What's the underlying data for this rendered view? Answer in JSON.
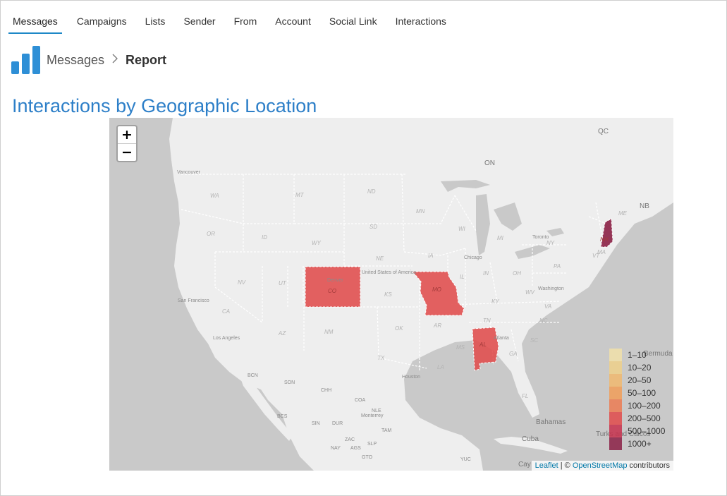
{
  "tabs": [
    {
      "label": "Messages",
      "active": true
    },
    {
      "label": "Campaigns"
    },
    {
      "label": "Lists"
    },
    {
      "label": "Sender"
    },
    {
      "label": "From"
    },
    {
      "label": "Account"
    },
    {
      "label": "Social Link"
    },
    {
      "label": "Interactions"
    }
  ],
  "breadcrumb": {
    "parent": "Messages",
    "separator": ">",
    "current": "Report"
  },
  "page_title": "Interactions by Geographic Location",
  "map": {
    "zoom_in": "+",
    "zoom_out": "−",
    "state_labels": [
      "WA",
      "MT",
      "ND",
      "MN",
      "OR",
      "ID",
      "WY",
      "SD",
      "WI",
      "MI",
      "NY",
      "NE",
      "IA",
      "NV",
      "UT",
      "CO",
      "KS",
      "MO",
      "IL",
      "IN",
      "OH",
      "PA",
      "CA",
      "KY",
      "WV",
      "VA",
      "AZ",
      "NM",
      "OK",
      "AR",
      "TN",
      "NC",
      "TX",
      "MS",
      "AL",
      "GA",
      "SC",
      "LA",
      "FL",
      "NH",
      "MA",
      "ME",
      "VT",
      "NB",
      "QC",
      "ON",
      "BCN",
      "SON",
      "CHH",
      "COA",
      "NLE",
      "TAM",
      "SIN",
      "DUR",
      "BCS",
      "ZAC",
      "SLP",
      "NAY",
      "AGS",
      "GTO",
      "YUC"
    ],
    "city_labels": [
      "Vancouver",
      "San Francisco",
      "Los Angeles",
      "Denver",
      "Chicago",
      "Toronto",
      "Washington",
      "Atlanta",
      "Houston",
      "Monterrey",
      "Bahamas",
      "Cuba",
      "Turks and Caicos",
      "Bermuda",
      "United States of America",
      "Cay"
    ],
    "highlighted": [
      {
        "state": "CO",
        "range": "100–200",
        "color": "#e05050"
      },
      {
        "state": "MO",
        "range": "100–200",
        "color": "#e05050"
      },
      {
        "state": "AL",
        "range": "100–200",
        "color": "#e05050"
      },
      {
        "state": "NH",
        "range": "1000+",
        "color": "#8b2045"
      }
    ],
    "legend": [
      {
        "label": "1–10",
        "color": "#f1e0a9"
      },
      {
        "label": "10–20",
        "color": "#efd08a"
      },
      {
        "label": "20–50",
        "color": "#f1b96f"
      },
      {
        "label": "50–100",
        "color": "#f19d58"
      },
      {
        "label": "100–200",
        "color": "#ec7b52"
      },
      {
        "label": "200–500",
        "color": "#e14a4a"
      },
      {
        "label": "500–1000",
        "color": "#c7304c"
      },
      {
        "label": "1000+",
        "color": "#8b2045"
      }
    ],
    "attribution": {
      "leaflet": "Leaflet",
      "sep": " | © ",
      "osm": "OpenStreetMap",
      "suffix": " contributors"
    }
  }
}
